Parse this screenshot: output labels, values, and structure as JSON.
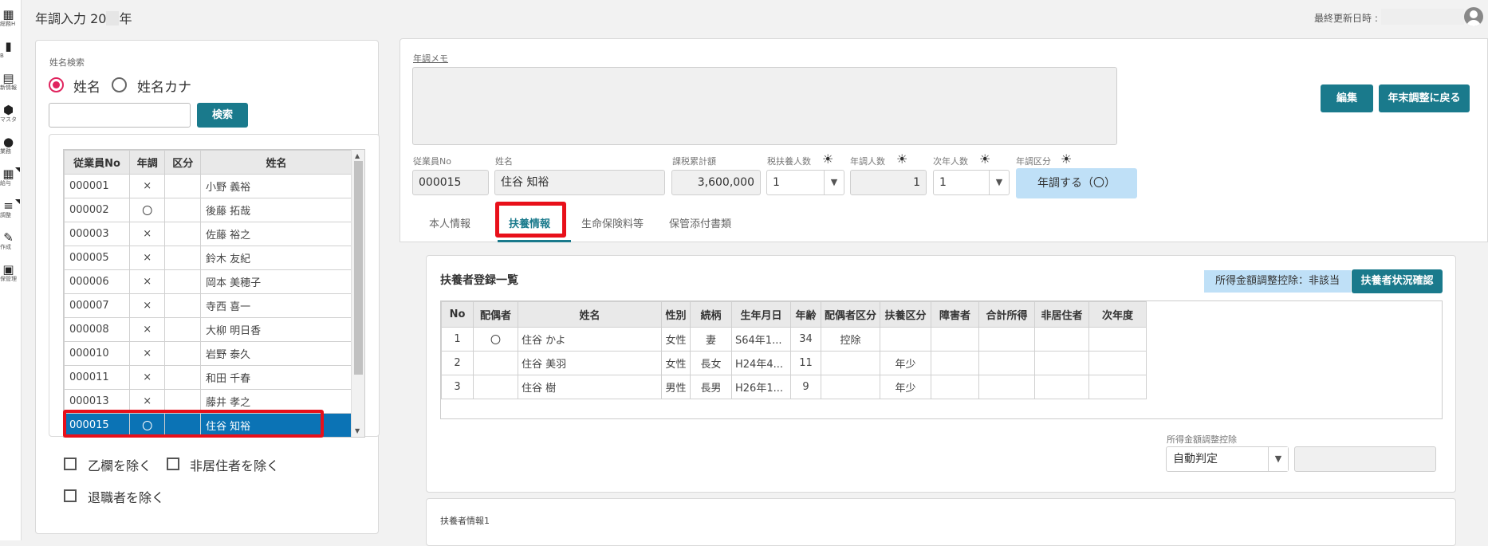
{
  "rail": {
    "items": [
      {
        "icon": "▦",
        "label": "総務H",
        "tri": false
      },
      {
        "icon": "▮",
        "label": "B",
        "tri": false
      },
      {
        "icon": "▤",
        "label": "新情報",
        "tri": false
      },
      {
        "icon": "⬢",
        "label": "マスタ",
        "tri": false
      },
      {
        "icon": "●",
        "label": "業務",
        "tri": false
      },
      {
        "icon": "▦",
        "label": "給与",
        "tri": true
      },
      {
        "icon": "≡",
        "label": "調整",
        "tri": true
      },
      {
        "icon": "✎",
        "label": "作成",
        "tri": false
      },
      {
        "icon": "▣",
        "label": "保管理",
        "tri": false
      }
    ]
  },
  "header": {
    "title_prefix": "年調入力 20",
    "title_suffix": "年",
    "last_updated_label": "最終更新日時 :"
  },
  "search": {
    "group_label": "姓名検索",
    "radio_name": "姓名",
    "radio_kana": "姓名カナ",
    "input_value": "",
    "button": "検索"
  },
  "employees": {
    "columns": [
      "従業員No",
      "年調",
      "区分",
      "姓名"
    ],
    "rows": [
      {
        "no": "000001",
        "adj": "×",
        "kubun": "",
        "name": "小野 義裕"
      },
      {
        "no": "000002",
        "adj": "〇",
        "kubun": "",
        "name": "後藤 拓哉"
      },
      {
        "no": "000003",
        "adj": "×",
        "kubun": "",
        "name": "佐藤 裕之"
      },
      {
        "no": "000005",
        "adj": "×",
        "kubun": "",
        "name": "鈴木 友紀"
      },
      {
        "no": "000006",
        "adj": "×",
        "kubun": "",
        "name": "岡本 美穂子"
      },
      {
        "no": "000007",
        "adj": "×",
        "kubun": "",
        "name": "寺西 喜一"
      },
      {
        "no": "000008",
        "adj": "×",
        "kubun": "",
        "name": "大柳 明日香"
      },
      {
        "no": "000010",
        "adj": "×",
        "kubun": "",
        "name": "岩野 泰久"
      },
      {
        "no": "000011",
        "adj": "×",
        "kubun": "",
        "name": "和田 千春"
      },
      {
        "no": "000013",
        "adj": "×",
        "kubun": "",
        "name": "藤井 孝之"
      },
      {
        "no": "000015",
        "adj": "〇",
        "kubun": "",
        "name": "住谷 知裕"
      }
    ],
    "selected_index": 10
  },
  "filters": {
    "exclude_otsu": "乙欄を除く",
    "exclude_nonresident": "非居住者を除く",
    "exclude_retired": "退職者を除く"
  },
  "memo": {
    "label": "年調メモ",
    "value": "",
    "edit_button": "編集",
    "back_button": "年末調整に戻る"
  },
  "fields": {
    "employee_no_label": "従業員No",
    "employee_no": "000015",
    "name_label": "姓名",
    "name": "住谷 知裕",
    "taxable_total_label": "課税累計額",
    "taxable_total": "3,600,000",
    "tax_dependents_label": "税扶養人数",
    "tax_dependents": "1",
    "adj_count_label": "年調人数",
    "adj_count": "1",
    "next_year_count_label": "次年人数",
    "next_year_count": "1",
    "adj_kubun_label": "年調区分",
    "adj_kubun": "年調する（〇）"
  },
  "tabs": [
    "本人情報",
    "扶養情報",
    "生命保険料等",
    "保管添付書類"
  ],
  "dependents": {
    "title": "扶養者登録一覧",
    "income_adj_status": "所得金額調整控除：非該当",
    "check_button": "扶養者状況確認",
    "columns": [
      "No",
      "配偶者",
      "姓名",
      "性別",
      "続柄",
      "生年月日",
      "年齢",
      "配偶者区分",
      "扶養区分",
      "障害者",
      "合計所得",
      "非居住者",
      "次年度"
    ],
    "rows": [
      {
        "no": "1",
        "spouse": "〇",
        "name": "住谷 かよ",
        "sex": "女性",
        "rel": "妻",
        "dob": "S64年1...",
        "age": "34",
        "spouse_kubun": "控除",
        "dep_kubun": "",
        "disabled": "",
        "income": "",
        "nonres": "",
        "next": ""
      },
      {
        "no": "2",
        "spouse": "",
        "name": "住谷 美羽",
        "sex": "女性",
        "rel": "長女",
        "dob": "H24年4...",
        "age": "11",
        "spouse_kubun": "",
        "dep_kubun": "年少",
        "disabled": "",
        "income": "",
        "nonres": "",
        "next": ""
      },
      {
        "no": "3",
        "spouse": "",
        "name": "住谷 樹",
        "sex": "男性",
        "rel": "長男",
        "dob": "H26年1...",
        "age": "9",
        "spouse_kubun": "",
        "dep_kubun": "年少",
        "disabled": "",
        "income": "",
        "nonres": "",
        "next": ""
      }
    ],
    "income_adj_label": "所得金額調整控除",
    "income_adj_value": "自動判定",
    "info_title": "扶養者情報1"
  },
  "colors": {
    "teal": "#1a7a8c",
    "selected_row": "#0b73b5",
    "highlight_red": "#e8101a",
    "badge_blue": "#bfe0f7",
    "radio_pink": "#e0245e"
  }
}
